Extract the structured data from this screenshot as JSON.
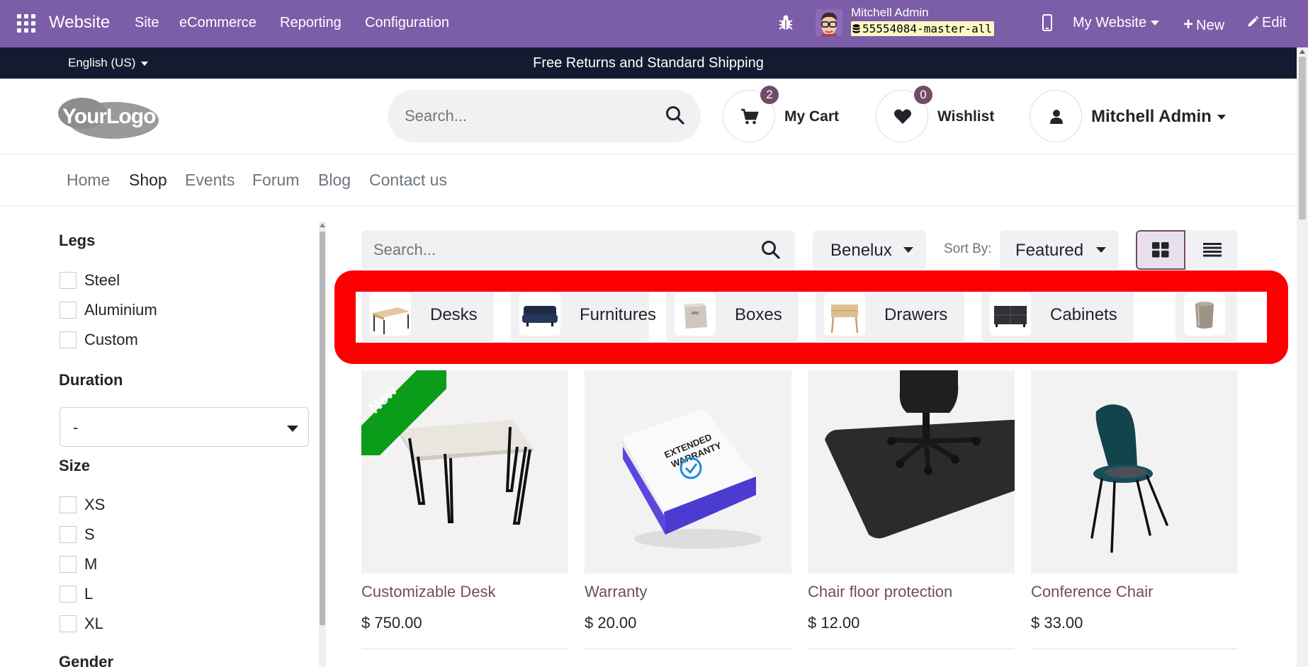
{
  "topbar": {
    "brand": "Website",
    "menus": [
      "Site",
      "eCommerce",
      "Reporting",
      "Configuration"
    ],
    "user_name": "Mitchell Admin",
    "database": "55554084-master-all",
    "my_website": "My Website",
    "new_label": "New",
    "edit_label": "Edit"
  },
  "announcement": {
    "language": "English (US)",
    "message": "Free Returns and Standard Shipping"
  },
  "header": {
    "logo_text": "YourLogo",
    "search_placeholder": "Search...",
    "cart_label": "My Cart",
    "cart_count": "2",
    "wishlist_label": "Wishlist",
    "wishlist_count": "0",
    "account_label": "Mitchell Admin"
  },
  "nav": {
    "items": [
      "Home",
      "Shop",
      "Events",
      "Forum",
      "Blog",
      "Contact us"
    ],
    "active": "Shop"
  },
  "sidebar": {
    "legs_title": "Legs",
    "legs_options": [
      "Steel",
      "Aluminium",
      "Custom"
    ],
    "duration_title": "Duration",
    "duration_value": "-",
    "size_title": "Size",
    "size_options": [
      "XS",
      "S",
      "M",
      "L",
      "XL"
    ],
    "gender_title": "Gender"
  },
  "toolbar": {
    "search_placeholder": "Search...",
    "pricelist": "Benelux",
    "sort_label": "Sort By:",
    "sort_value": "Featured"
  },
  "categories": [
    "Desks",
    "Furnitures",
    "Boxes",
    "Drawers",
    "Cabinets"
  ],
  "products": [
    {
      "name": "Customizable Desk",
      "price": "$ 750.00",
      "ribbon": "New"
    },
    {
      "name": "Warranty",
      "price": "$ 20.00",
      "box_text": "EXTENDED WARRANTY"
    },
    {
      "name": "Chair floor protection",
      "price": "$ 12.00"
    },
    {
      "name": "Conference Chair",
      "price": "$ 33.00"
    }
  ],
  "colors": {
    "topbar": "#7c5da8",
    "announcement": "#141a30",
    "accent": "#714b67",
    "highlight": "#fb0000",
    "ribbon": "#0b9c1a"
  }
}
